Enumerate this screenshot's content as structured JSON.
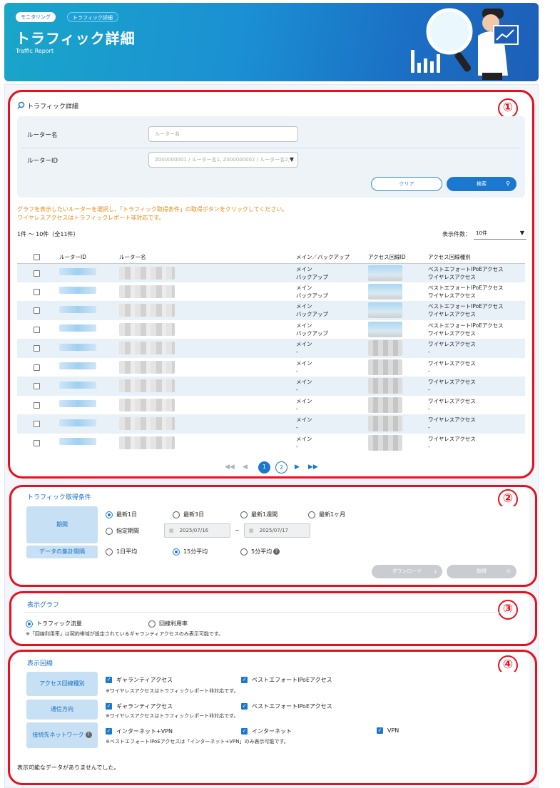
{
  "header": {
    "breadcrumb": [
      "モニタリング",
      "トラフィック詳細"
    ],
    "title": "トラフィック詳細",
    "subtitle": "Traffic Report"
  },
  "callouts": [
    "①",
    "②",
    "③",
    "④"
  ],
  "search": {
    "section_title": "トラフィック詳細",
    "router_name_label": "ルーター名",
    "router_name_placeholder": "ルーター名",
    "router_id_label": "ルーターID",
    "router_id_placeholder": "Z000000001 / ルーター名1, Z000000002 / ルーター名2, ...",
    "clear_label": "クリア",
    "search_label": "検索"
  },
  "notice": [
    "グラフを表示したいルーターを選択し、「トラフィック取得条件」の取得ボタンをクリックしてください。",
    "ワイヤレスアクセスはトラフィックレポート非対応です。"
  ],
  "list": {
    "count_text": "1件 〜 10件（全11件）",
    "page_size_label": "表示件数：",
    "page_size_value": "10件",
    "columns": [
      "ルーターID",
      "ルーター名",
      "メイン／バックアップ",
      "アクセス回線ID",
      "アクセス回線種別"
    ],
    "rows": [
      {
        "role1": "メイン",
        "role2": "バックアップ",
        "type1": "ベストエフォートIPoEアクセス",
        "type2": "ワイヤレスアクセス",
        "acc": "blue"
      },
      {
        "role1": "メイン",
        "role2": "バックアップ",
        "type1": "ベストエフォートIPoEアクセス",
        "type2": "ワイヤレスアクセス",
        "acc": "blue"
      },
      {
        "role1": "メイン",
        "role2": "バックアップ",
        "type1": "ベストエフォートIPoEアクセス",
        "type2": "ワイヤレスアクセス",
        "acc": "blue"
      },
      {
        "role1": "メイン",
        "role2": "バックアップ",
        "type1": "ベストエフォートIPoEアクセス",
        "type2": "ワイヤレスアクセス",
        "acc": "blue"
      },
      {
        "role1": "メイン",
        "role2": "-",
        "type1": "ワイヤレスアクセス",
        "type2": "-",
        "acc": "grey"
      },
      {
        "role1": "メイン",
        "role2": "-",
        "type1": "ワイヤレスアクセス",
        "type2": "-",
        "acc": "grey"
      },
      {
        "role1": "メイン",
        "role2": "-",
        "type1": "ワイヤレスアクセス",
        "type2": "-",
        "acc": "grey"
      },
      {
        "role1": "メイン",
        "role2": "-",
        "type1": "ワイヤレスアクセス",
        "type2": "-",
        "acc": "grey"
      },
      {
        "role1": "メイン",
        "role2": "-",
        "type1": "ワイヤレスアクセス",
        "type2": "-",
        "acc": "grey"
      },
      {
        "role1": "メイン",
        "role2": "-",
        "type1": "ワイヤレスアクセス",
        "type2": "-",
        "acc": "grey"
      }
    ],
    "pages": [
      "1",
      "2"
    ],
    "current_page": "1"
  },
  "conditions": {
    "title": "トラフィック取得条件",
    "period_label": "期間",
    "period_options": [
      "最新1日",
      "最新3日",
      "最新1週間",
      "最新1ヶ月",
      "指定期間"
    ],
    "date_from": "2025/07/16",
    "date_sep": "~",
    "date_to": "2025/07/17",
    "interval_label": "データの集計間隔",
    "interval_options": [
      "1日平均",
      "15分平均",
      "5分平均"
    ],
    "download_label": "ダウンロード",
    "fetch_label": "取得"
  },
  "graph": {
    "title": "表示グラフ",
    "options": [
      "トラフィック流量",
      "回線利用率"
    ],
    "note": "※「回線利用率」は契約帯域が設定されているギャランティアクセスのみ表示可能です。"
  },
  "lines": {
    "title": "表示回線",
    "access_type_label": "アクセス回線種別",
    "access_options": [
      "ギャランティアクセス",
      "ベストエフォートIPoEアクセス"
    ],
    "access_note": "※ワイヤレスアクセスはトラフィックレポート非対応です。",
    "direction_label": "通信方向",
    "direction_options": [
      "ギャランティアクセス",
      "ベストエフォートIPoEアクセス"
    ],
    "direction_note": "※ワイヤレスアクセスはトラフィックレポート非対応です。",
    "network_label": "接続先ネットワーク",
    "network_options": [
      "インターネット+VPN",
      "インターネット",
      "VPN"
    ],
    "network_note": "※ベストエフォートIPoEアクセスは「インターネット+VPN」のみ表示可能です。",
    "empty_message": "表示可能なデータがありませんでした。"
  },
  "colors": {
    "brand": "#1b78cf",
    "callout": "#e8101c",
    "notice": "#e58a10"
  }
}
